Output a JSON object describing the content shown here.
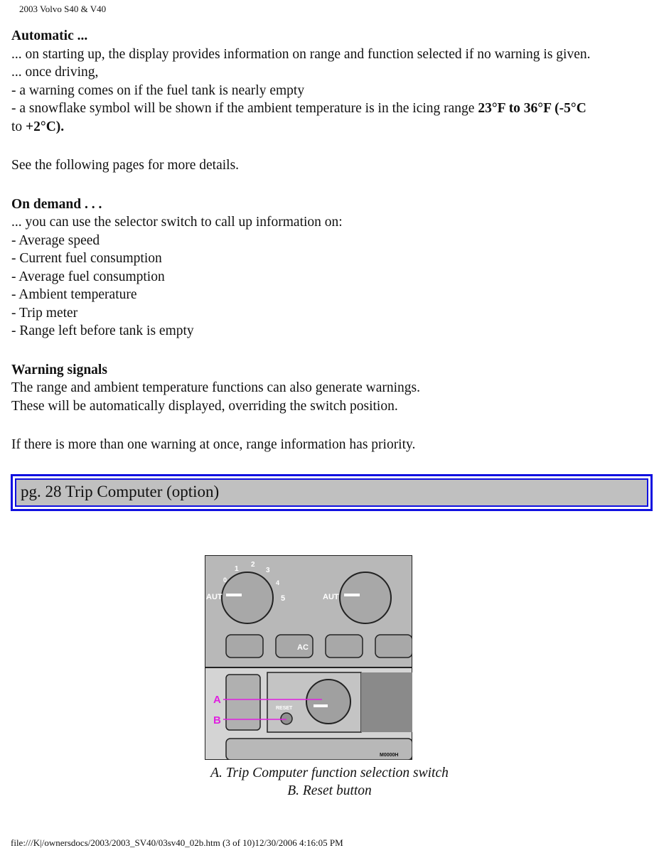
{
  "header": {
    "title": "2003 Volvo S40 & V40"
  },
  "automatic": {
    "heading": "Automatic ...",
    "line1": "... on starting up, the display provides information on range and function selected if no warning is given.",
    "line2": "... once driving,",
    "line3": "- a warning comes on if the fuel tank is nearly empty",
    "line4_pre": "- a snowflake symbol will be shown if the ambient temperature is in the icing range ",
    "line4_bold": "23°F to 36°F (-5°C",
    "line5_pre": "to ",
    "line5_bold": "+2°C).",
    "see_more": "See the following pages for more details."
  },
  "on_demand": {
    "heading": "On demand . . .",
    "intro": "... you can use the selector switch to call up information on:",
    "items": [
      "- Average speed",
      "- Current fuel consumption",
      "- Average fuel consumption",
      "- Ambient temperature",
      "- Trip meter",
      "- Range left before tank is empty"
    ]
  },
  "warning": {
    "heading": "Warning signals",
    "line1": "The range and ambient temperature functions can also generate warnings.",
    "line2": "These will be automatically displayed, overriding the switch position.",
    "priority": "If there is more than one warning at once, range information has priority."
  },
  "section_banner": {
    "title": "pg. 28 Trip Computer (option)"
  },
  "figure": {
    "labels": {
      "a": "A",
      "b": "B",
      "aut": "AUT",
      "reset": "RESET",
      "fan_scale": [
        "0",
        "1",
        "2",
        "3",
        "4",
        "5"
      ],
      "ac": "AC",
      "code": "M0000H"
    },
    "colors": {
      "callout": "#e020e0",
      "panel": "#b8b8b8"
    }
  },
  "captions": {
    "a": "A. Trip Computer function selection switch",
    "b": "B. Reset button"
  },
  "footer": {
    "text": "file:///K|/ownersdocs/2003/2003_SV40/03sv40_02b.htm (3 of 10)12/30/2006 4:16:05 PM"
  }
}
